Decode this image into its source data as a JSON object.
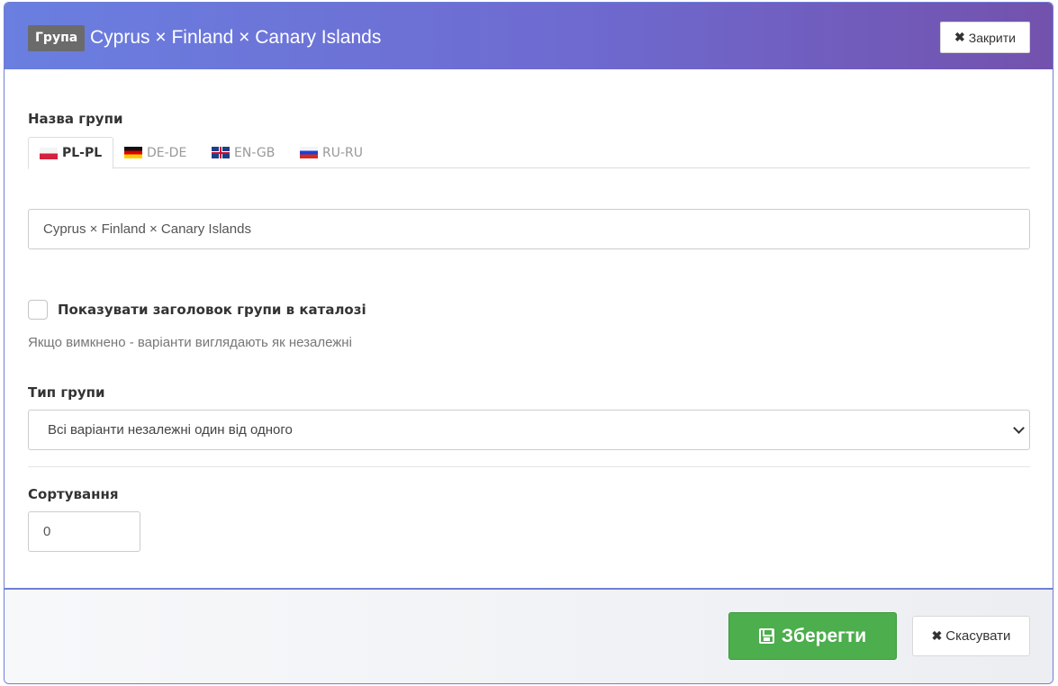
{
  "header": {
    "badge": "Група",
    "title": "Cyprus × Finland × Canary Islands",
    "close_label": "Закрити"
  },
  "group_name": {
    "label": "Назва групи",
    "tabs": [
      {
        "code": "PL-PL",
        "flag": "poland-flag-icon",
        "active": true
      },
      {
        "code": "DE-DE",
        "flag": "germany-flag-icon",
        "active": false
      },
      {
        "code": "EN-GB",
        "flag": "uk-flag-icon",
        "active": false
      },
      {
        "code": "RU-RU",
        "flag": "russia-flag-icon",
        "active": false
      }
    ],
    "value": "Cyprus × Finland  × Canary Islands"
  },
  "show_header": {
    "label": "Показувати заголовок групи в каталозі",
    "checked": false,
    "help": "Якщо вимкнено - варіанти виглядають як незалежні"
  },
  "group_type": {
    "label": "Тип групи",
    "selected": "Всі варіанти незалежні один від одного"
  },
  "sorting": {
    "label": "Сортування",
    "value": "0"
  },
  "footer": {
    "save_label": "Зберегти",
    "cancel_label": "Скасувати"
  },
  "colors": {
    "header_gradient_start": "#6a7fe0",
    "header_gradient_end": "#7352ad",
    "save_button": "#4cae4c"
  }
}
